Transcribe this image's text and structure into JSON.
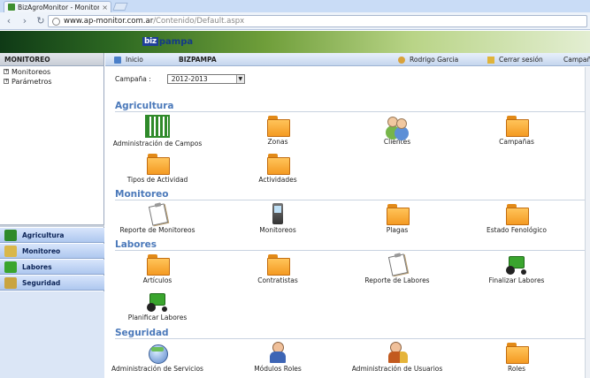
{
  "browser": {
    "tab_title": "BizAgroMonitor - Monitore",
    "tab_close": "×",
    "url_host": "www.ap-monitor.com.ar",
    "url_path": "/Contenido/Default.aspx",
    "back": "‹",
    "forward": "›",
    "reload": "↻"
  },
  "banner": {
    "logo_box": "biz",
    "logo_rest": "pampa"
  },
  "sidebar": {
    "header": "MONITOREO",
    "tree": [
      {
        "label": "Monitoreos"
      },
      {
        "label": "Parámetros"
      }
    ],
    "nav": [
      {
        "label": "Agricultura",
        "color": "#2f8a2a"
      },
      {
        "label": "Monitoreo",
        "color": "#d9b74a"
      },
      {
        "label": "Labores",
        "color": "#3aa52e"
      },
      {
        "label": "Seguridad",
        "color": "#c9a441"
      }
    ]
  },
  "topnav": {
    "home": "Inicio",
    "company": "BIZPAMPA",
    "user": "Rodrigo Garcia",
    "logout": "Cerrar sesión",
    "campaign_short": "Campaña"
  },
  "campaign": {
    "label": "Campaña :",
    "value": "2012-2013"
  },
  "sections": {
    "agricultura": {
      "title": "Agricultura",
      "items": [
        "Administración de Campos",
        "Zonas",
        "Clientes",
        "Campañas",
        "Tipos de Actividad",
        "Actividades"
      ]
    },
    "monitoreo": {
      "title": "Monitoreo",
      "items": [
        "Reporte de Monitoreos",
        "Monitoreos",
        "Plagas",
        "Estado Fenológico"
      ]
    },
    "labores": {
      "title": "Labores",
      "items": [
        "Artículos",
        "Contratistas",
        "Reporte de Labores",
        "Finalizar Labores",
        "Planificar Labores"
      ]
    },
    "seguridad": {
      "title": "Seguridad",
      "items": [
        "Administración de Servicios",
        "Módulos Roles",
        "Administración de Usuarios",
        "Roles"
      ]
    }
  }
}
